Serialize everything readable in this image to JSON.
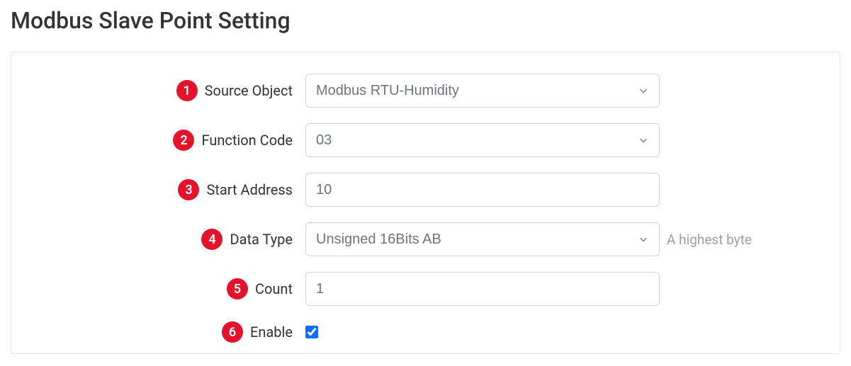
{
  "page_title": "Modbus Slave Point Setting",
  "fields": {
    "source_object": {
      "num": "1",
      "label": "Source Object",
      "value": "Modbus RTU-Humidity"
    },
    "function_code": {
      "num": "2",
      "label": "Function Code",
      "value": "03"
    },
    "start_address": {
      "num": "3",
      "label": "Start Address",
      "value": "10"
    },
    "data_type": {
      "num": "4",
      "label": "Data Type",
      "value": "Unsigned 16Bits AB",
      "hint": "A highest byte"
    },
    "count": {
      "num": "5",
      "label": "Count",
      "value": "1"
    },
    "enable": {
      "num": "6",
      "label": "Enable",
      "checked": true
    }
  }
}
